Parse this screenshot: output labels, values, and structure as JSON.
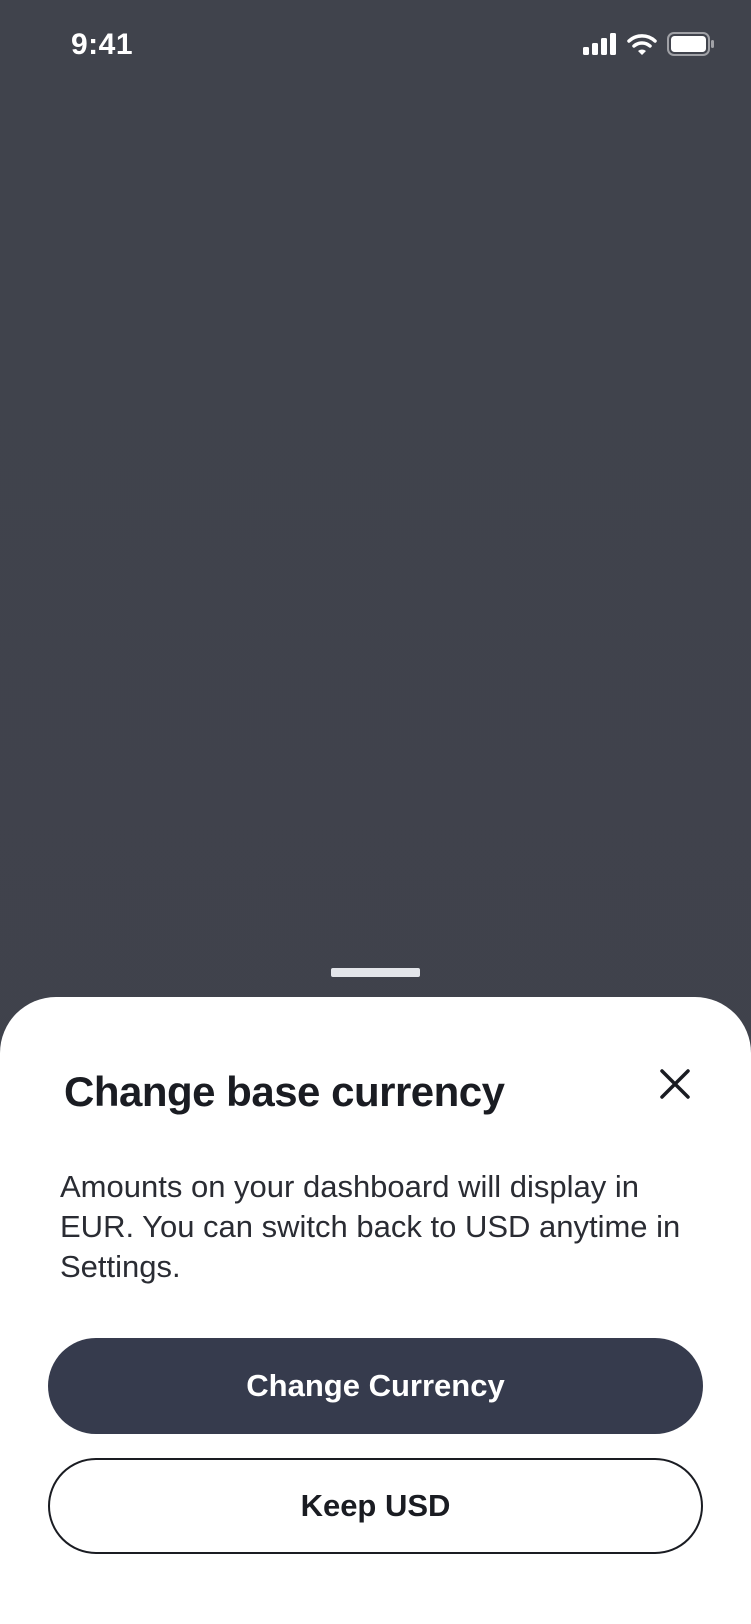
{
  "status_bar": {
    "time": "9:41",
    "icons": [
      "cellular-signal-icon",
      "wifi-icon",
      "battery-icon"
    ]
  },
  "sheet": {
    "title": "Change base currency",
    "body": "Amounts on your dashboard will display in EUR. You can switch back to USD anytime in Settings.",
    "primary_button_label": "Change Currency",
    "secondary_button_label": "Keep USD",
    "close_icon": "close-icon"
  },
  "colors": {
    "backdrop": "#3f424b",
    "sheet_background": "#ffffff",
    "primary_button": "#363b4d",
    "text_dark": "#1a1c22",
    "grabber": "#e3e5ea"
  }
}
